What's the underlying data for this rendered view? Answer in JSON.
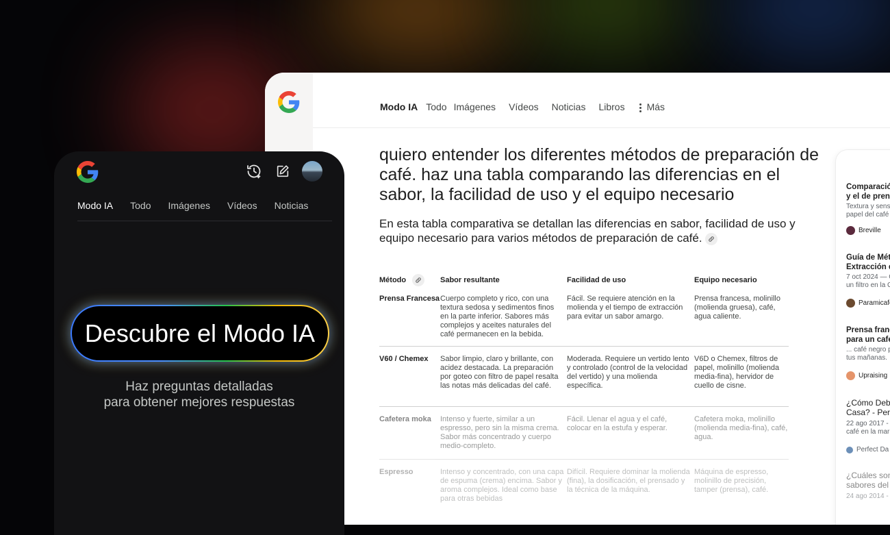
{
  "desktop": {
    "nav": [
      "Modo IA",
      "Todo",
      "Imágenes",
      "Vídeos",
      "Noticias",
      "Libros"
    ],
    "more_label": "Más",
    "query": "quiero entender los diferentes métodos de preparación de café. haz una tabla comparando las diferencias en el sabor, la facilidad de uso y el equipo necesario",
    "answer": "En esta tabla comparativa se detallan las diferencias en sabor, facilidad de uso y equipo necesario para varios métodos de preparación de café.",
    "table": {
      "headers": [
        "Método",
        "Sabor resultante",
        "Facilidad de uso",
        "Equipo necesario"
      ],
      "rows": [
        [
          "Prensa Francesa",
          "Cuerpo completo y rico, con una textura sedosa y sedimentos finos en la parte inferior. Sabores más complejos y aceites naturales del café permanecen en la bebida.",
          "Fácil. Se requiere atención en la molienda y el tiempo de extracción para evitar un sabor amargo.",
          "Prensa francesa, molinillo (molienda gruesa), café, agua caliente."
        ],
        [
          "V60 / Chemex",
          "Sabor limpio, claro y brillante, con acidez destacada. La preparación por goteo con filtro de papel resalta las notas más delicadas del café.",
          "Moderada. Requiere un vertido lento y controlado (control de la velocidad del vertido) y una molienda específica.",
          "V6D o Chemex, filtros de papel, molinillo (molienda media-fina), hervidor de cuello de cisne."
        ],
        [
          "Cafetera moka",
          "Intenso y fuerte, similar a un espresso, pero sin la misma crema. Sabor más concentrado y cuerpo medio-completo.",
          "Fácil. Llenar el agua y el café, colocar en la estufa y esperar.",
          "Cafetera moka, molinillo (molienda media-fina), café, agua."
        ],
        [
          "Espresso",
          "Intenso y concentrado, con una capa de espuma (crema) encima. Sabor y aroma complejos. Ideal como base para otras bebidas",
          "Difícil. Requiere dominar la molienda (fina), la dosificación, el prensado y la técnica de la máquina.",
          "Máquina de espresso, molinillo de precisión, tamper (prensa), café."
        ]
      ]
    },
    "sources": [
      {
        "title": [
          "Comparació",
          "y el de prens"
        ],
        "snippet": [
          "Textura y sens",
          "papel del café"
        ],
        "site": "Breville",
        "color": "#5b2a3d"
      },
      {
        "title": [
          "Guía de Mét",
          "Extracción d"
        ],
        "snippet": [
          "7 oct 2024 — C",
          "un filtro en la C"
        ],
        "site": "Paramicafe",
        "color": "#6b4a2f"
      },
      {
        "title": [
          "Prensa franc",
          "para un café"
        ],
        "snippet": [
          "... café negro p",
          "tus mañanas."
        ],
        "site": "Upraising",
        "color": "#e5946a"
      },
      {
        "title": [
          "¿Cómo Debe",
          "Casa? - Perf"
        ],
        "snippet": [
          "22 ago 2017 -",
          "café en la mar"
        ],
        "site": "Perfect Da",
        "color": "#6c8fb8"
      },
      {
        "title": [
          "¿Cuáles son",
          "sabores del"
        ],
        "snippet": [
          "24 ago 2014 -"
        ],
        "site": "",
        "color": "#cccccc"
      }
    ]
  },
  "phone": {
    "tabs": [
      "Modo IA",
      "Todo",
      "Imágenes",
      "Vídeos",
      "Noticias"
    ],
    "cta": "Descubre el Modo IA",
    "subtitle": [
      "Haz preguntas detalladas",
      "para obtener mejores respuestas"
    ]
  },
  "colors": {
    "google_blue": "#4285F4",
    "google_red": "#EA4335",
    "google_yellow": "#FBBC05",
    "google_green": "#34A853"
  }
}
